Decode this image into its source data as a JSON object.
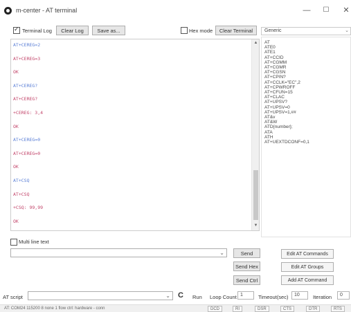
{
  "window": {
    "title": "m-center - AT terminal",
    "min_glyph": "—",
    "max_glyph": "☐",
    "close_glyph": "✕"
  },
  "toolbar": {
    "terminal_log_label": "Terminal Log",
    "terminal_log_checked": true,
    "clear_log_label": "Clear Log",
    "save_as_label": "Save as...",
    "hex_mode_label": "Hex mode",
    "hex_mode_checked": false,
    "clear_terminal_label": "Clear Terminal"
  },
  "terminal": {
    "lines": [
      {
        "text": "AT+CEREG=2",
        "kind": "cmd"
      },
      {
        "text": "AT+CEREG=3",
        "kind": "resp"
      },
      {
        "text": "OK",
        "kind": "ok"
      },
      {
        "text": "AT+CEREG?",
        "kind": "cmd"
      },
      {
        "text": "AT+CEREG?",
        "kind": "resp"
      },
      {
        "text": "+CEREG: 3,4",
        "kind": "resp"
      },
      {
        "text": "OK",
        "kind": "ok"
      },
      {
        "text": "AT+CEREG=0",
        "kind": "cmd"
      },
      {
        "text": "AT+CEREG=0",
        "kind": "resp"
      },
      {
        "text": "OK",
        "kind": "ok"
      },
      {
        "text": "AT+CSQ",
        "kind": "cmd"
      },
      {
        "text": "AT+CSQ",
        "kind": "resp"
      },
      {
        "text": "+CSQ: 99,99",
        "kind": "resp"
      },
      {
        "text": "OK",
        "kind": "ok"
      }
    ],
    "scroll_up": "▲",
    "scroll_down": "▼"
  },
  "sidebar": {
    "group_selected": "Generic",
    "caret": "⌄",
    "commands": [
      "AT",
      "ATE0",
      "ATE1",
      "AT+CCID",
      "AT+CGMM",
      "AT+CGMR",
      "AT+CGSN",
      "AT+CPIN?",
      "AT+CCLK=\"EC\",2",
      "AT+CPWROFF",
      "AT+CFUN=15",
      "AT+CLAC",
      "AT+UPSV?",
      "AT+UPSV=0",
      "AT+UPSV=1,##",
      "AT&v",
      "AT&W",
      "ATD{number};",
      "ATA",
      "ATH",
      "AT+UEXTDCONF=0,1"
    ]
  },
  "input": {
    "multiline_label": "Multi line text",
    "send_label": "Send",
    "send_hex_label": "Send Hex",
    "send_ctrl_label": "Send Ctrl",
    "caret": "⌄"
  },
  "side_buttons": {
    "edit_at_commands": "Edit AT Commands",
    "edit_at_groups": "Edit AT Groups",
    "add_at_command": "Add AT Command"
  },
  "scriptbar": {
    "at_script_label": "AT script",
    "refresh_icon": "C",
    "run_label": "Run",
    "loop_count_label": "Loop Count",
    "loop_count_value": "1",
    "timeout_label": "Timeout(sec)",
    "timeout_value": "10",
    "iteration_label": "Iteration",
    "iteration_value": "0",
    "caret": "⌄"
  },
  "status": {
    "text": "AT: COM24 115200 8 none 1 flow ctrl: hardware - conn",
    "dcd": "DCD",
    "ri": "RI",
    "dsr": "DSR",
    "cts": "CTS",
    "dtr": "DTR",
    "rts": "RTS"
  }
}
